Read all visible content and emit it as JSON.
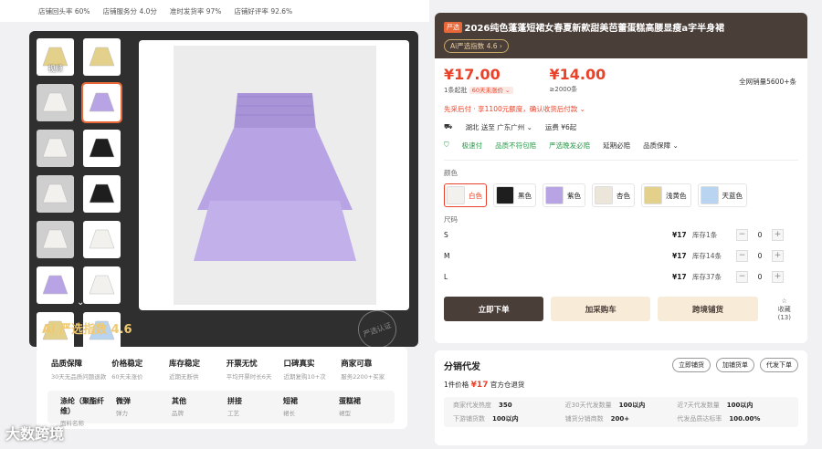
{
  "store_stats": [
    "店铺回头率 60%",
    "店铺服务分 4.0分",
    "准时发货率 97%",
    "店铺好评率 92.6%"
  ],
  "gallery": {
    "video_label": "视频",
    "thumbs": [
      "yellow",
      "yellow",
      "white",
      "purple",
      "white",
      "black",
      "white",
      "black",
      "white",
      "white",
      "purple",
      "white",
      "yellow",
      "blue"
    ],
    "main_color": "#b8a4e4"
  },
  "ai_index_big": "Ai 严选指数 4.6",
  "stamp": "严选认证",
  "guarantees": [
    {
      "title": "品质保障",
      "sub": "30天无品质问题退款"
    },
    {
      "title": "价格稳定",
      "sub": "60天未涨价"
    },
    {
      "title": "库存稳定",
      "sub": "近期无断供"
    },
    {
      "title": "开票无忧",
      "sub": "平均开票时长6天"
    },
    {
      "title": "口碑真实",
      "sub": "近期复购10+次"
    },
    {
      "title": "商家可靠",
      "sub": "服务2200+买家"
    }
  ],
  "attributes": [
    {
      "title": "涤纶（聚酯纤维）",
      "sub": "面料名称"
    },
    {
      "title": "微弹",
      "sub": "弹力"
    },
    {
      "title": "其他",
      "sub": "品牌"
    },
    {
      "title": "拼接",
      "sub": "工艺"
    },
    {
      "title": "短裙",
      "sub": "裙长"
    },
    {
      "title": "蛋糕裙",
      "sub": "裙型"
    }
  ],
  "brand": "大数跨境",
  "product": {
    "tag": "严选",
    "title": "2026纯色蓬蓬短裙女春夏新款甜美芭蕾蛋糕高腰显瘦a字半身裙",
    "ai_index": "Ai严选指数 4.6 ›",
    "price1": "¥17.00",
    "price1_sub": "1条起批",
    "badge": "60天未涨价 ⌄",
    "price2": "¥14.00",
    "price2_sub": "≥2000条",
    "sales": "全网销量5600+条",
    "pay_note": "先采后付 · 享1100元额度，确认收货后付款 ⌄",
    "ship_from": "湖北 送至 广东广州 ⌄",
    "ship_fee": "运费 ¥6起",
    "services": [
      "极速付",
      "品质不符包赔",
      "严选晚发必赔",
      "延期必赔",
      "品质保障 ⌄"
    ],
    "color_label": "颜色",
    "colors": [
      {
        "name": "白色",
        "hex": "#f3f1ee"
      },
      {
        "name": "黑色",
        "hex": "#1e1e1e"
      },
      {
        "name": "紫色",
        "hex": "#b8a4e4"
      },
      {
        "name": "杏色",
        "hex": "#ece6da"
      },
      {
        "name": "浅黄色",
        "hex": "#e3d08a"
      },
      {
        "name": "天蓝色",
        "hex": "#b8d4f0"
      }
    ],
    "size_label": "尺码",
    "sizes": [
      {
        "name": "S",
        "price": "¥17",
        "stock": "库存1条",
        "qty": "0"
      },
      {
        "name": "M",
        "price": "¥17",
        "stock": "库存14条",
        "qty": "0"
      },
      {
        "name": "L",
        "price": "¥17",
        "stock": "库存37条",
        "qty": "0"
      }
    ],
    "buttons": {
      "order": "立即下单",
      "cart": "加采购车",
      "dropship": "跨境铺货",
      "fav": "收藏 (13)"
    }
  },
  "distribution": {
    "title": "分销代发",
    "buttons": [
      "立即铺货",
      "加铺货单",
      "代发下单"
    ],
    "info_prefix": "1件价格",
    "price": "¥17",
    "info_suffix": "官方仓退货",
    "stats": [
      {
        "k": "商家代发热度",
        "v": "350"
      },
      {
        "k": "近30天代发数量",
        "v": "100以内"
      },
      {
        "k": "近7天代发数量",
        "v": "100以内"
      },
      {
        "k": "下游铺货数",
        "v": "100以内"
      },
      {
        "k": "铺货分销商数",
        "v": "200+"
      },
      {
        "k": "代发品质达标率",
        "v": "100.00%"
      }
    ]
  }
}
